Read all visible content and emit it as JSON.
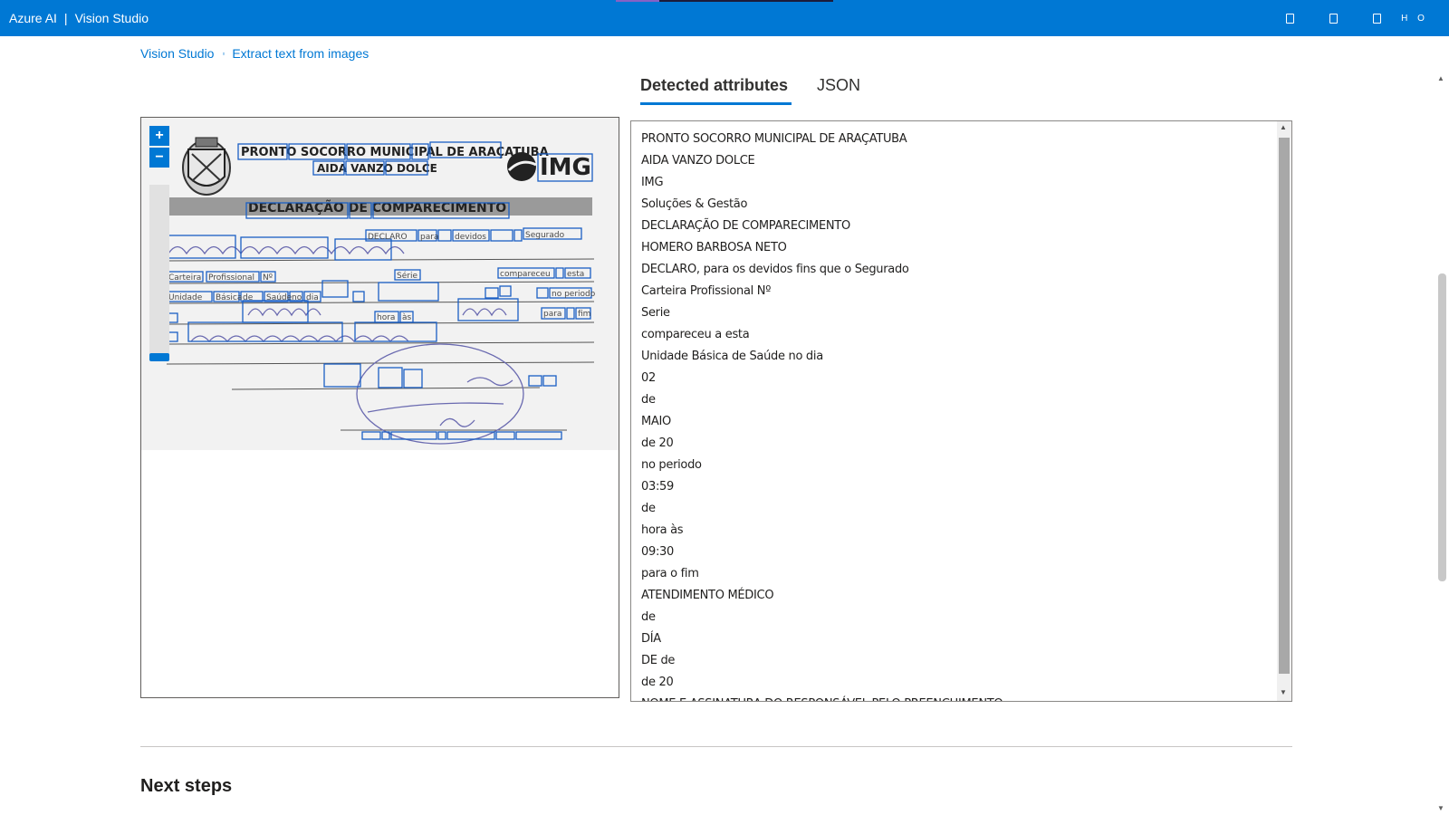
{
  "topbar": {
    "brand": "Azure AI",
    "separator": "|",
    "product": "Vision Studio",
    "tool_icons": [
      "document-icon",
      "document-icon",
      "document-icon",
      "help-icon"
    ],
    "last_tool_label": "H O"
  },
  "breadcrumb": {
    "items": [
      "Vision Studio",
      "Extract text from images"
    ]
  },
  "tabs": {
    "active": "Detected attributes",
    "items": [
      "Detected attributes",
      "JSON"
    ]
  },
  "image_panel": {
    "zoom_in": "+",
    "zoom_out": "−",
    "document": {
      "header_line1": [
        "PRONTO",
        "SOCORRO",
        "MUNICIPAL",
        "DE",
        "ARAÇATUBA"
      ],
      "header_line2": [
        "AIDA",
        "VANZO",
        "DOLCE"
      ],
      "logo": "IMG",
      "title": "DECLARAÇÃO DE COMPARECIMENTO"
    }
  },
  "detected_text": [
    "PRONTO SOCORRO MUNICIPAL DE ARAÇATUBA",
    "AIDA VANZO DOLCE",
    "IMG",
    "Soluções & Gestão",
    "DECLARAÇÃO DE COMPARECIMENTO",
    "HOMERO BARBOSA NETO",
    "DECLARO, para os devidos fins que o Segurado",
    "Carteira Profissional Nº",
    "Serie",
    "compareceu a esta",
    "Unidade Básica de Saúde no dia",
    "02",
    "de",
    "MAIO",
    "de 20",
    "no periodo",
    "03:59",
    "de",
    "hora às",
    "09:30",
    "para o fim",
    "ATENDIMENTO MÉDICO",
    "de",
    "DÍA",
    "DE de",
    "de 20",
    "NOME E ASSINATURA DO RESPONSÁVEL PELO PREENCHIMENTO"
  ],
  "footer": {
    "next_steps": "Next steps"
  },
  "colors": {
    "accent": "#0078d4",
    "bounding_box": "#1a5fc4"
  }
}
